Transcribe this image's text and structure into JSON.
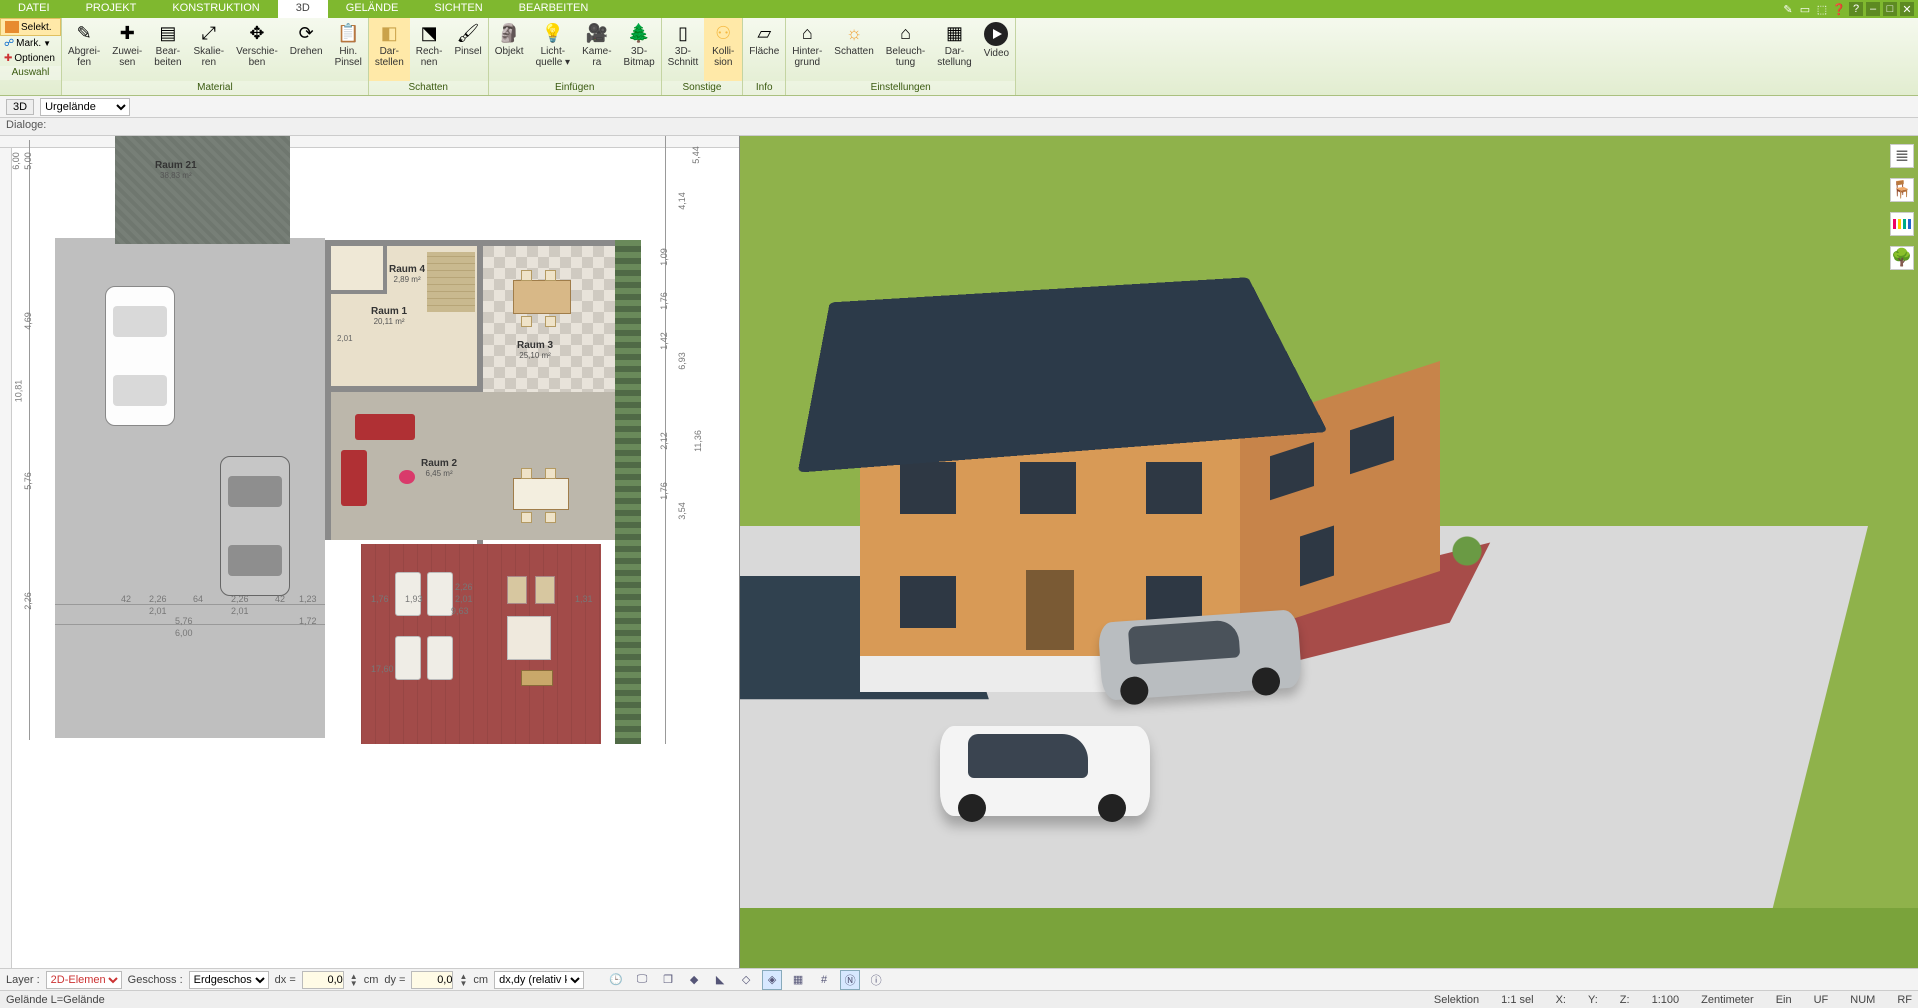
{
  "menu": {
    "tabs": [
      "DATEI",
      "PROJEKT",
      "KONSTRUKTION",
      "3D",
      "GELÄNDE",
      "SICHTEN",
      "BEARBEITEN"
    ],
    "active_index": 3
  },
  "ribbon": {
    "left": {
      "select": "Selekt.",
      "mark": "Mark.",
      "options": "Optionen",
      "group": "Auswahl"
    },
    "groups": [
      {
        "title": "Material",
        "buttons": [
          {
            "id": "abgreifen",
            "label": "Abgrei-\nfen",
            "glyph": "✎"
          },
          {
            "id": "zuweisen",
            "label": "Zuwei-\nsen",
            "glyph": "✚"
          },
          {
            "id": "bearbeiten",
            "label": "Bear-\nbeiten",
            "glyph": "▤"
          },
          {
            "id": "skalieren",
            "label": "Skalie-\nren",
            "glyph": "⤢"
          },
          {
            "id": "verschieben",
            "label": "Verschie-\nben",
            "glyph": "✥"
          },
          {
            "id": "drehen",
            "label": "Drehen",
            "glyph": "⟳"
          },
          {
            "id": "hinpinsel",
            "label": "Hin.\nPinsel",
            "glyph": "📋"
          }
        ]
      },
      {
        "title": "Schatten",
        "buttons": [
          {
            "id": "darstellen",
            "label": "Dar-\nstellen",
            "glyph": "◧",
            "hl": true
          },
          {
            "id": "rechnen",
            "label": "Rech-\nnen",
            "glyph": "⬔"
          },
          {
            "id": "pinsel",
            "label": "Pinsel",
            "glyph": "🖌"
          }
        ]
      },
      {
        "title": "Einfügen",
        "buttons": [
          {
            "id": "objekt",
            "label": "Objekt",
            "glyph": "🗿"
          },
          {
            "id": "lichtquelle",
            "label": "Licht-\nquelle ▾",
            "glyph": "💡"
          },
          {
            "id": "kamera",
            "label": "Kame-\nra",
            "glyph": "🎥"
          },
          {
            "id": "3dbitmap",
            "label": "3D-\nBitmap",
            "glyph": "🌲"
          }
        ]
      },
      {
        "title": "Sonstige",
        "buttons": [
          {
            "id": "3dschnitt",
            "label": "3D-\nSchnitt",
            "glyph": "▯"
          },
          {
            "id": "kollision",
            "label": "Kolli-\nsion",
            "glyph": "⚇",
            "hl": true
          }
        ]
      },
      {
        "title": "Info",
        "buttons": [
          {
            "id": "flaeche",
            "label": "Fläche",
            "glyph": "▱"
          }
        ]
      },
      {
        "title": "Einstellungen",
        "buttons": [
          {
            "id": "hintergrund",
            "label": "Hinter-\ngrund",
            "glyph": "⌂"
          },
          {
            "id": "schattenset",
            "label": "Schatten",
            "glyph": "☼"
          },
          {
            "id": "beleuchtung",
            "label": "Beleuch-\ntung",
            "glyph": "⌂"
          },
          {
            "id": "darstellung",
            "label": "Dar-\nstellung",
            "glyph": "▦"
          },
          {
            "id": "video",
            "label": "Video",
            "glyph": ""
          }
        ]
      }
    ]
  },
  "subbar": {
    "mode": "3D",
    "layer": "Urgelände"
  },
  "dialoge_label": "Dialoge:",
  "plan": {
    "rooms": {
      "r21": {
        "name": "Raum 21",
        "area": "38,83 m²"
      },
      "r4": {
        "name": "Raum 4",
        "area": "2,89 m²"
      },
      "r1": {
        "name": "Raum 1",
        "area": "20,11 m²"
      },
      "r3": {
        "name": "Raum 3",
        "area": "25,10 m²"
      },
      "r2": {
        "name": "Raum 2",
        "area": "6,45 m²"
      }
    },
    "dims_left": [
      "6,00",
      "5,00",
      "4,69",
      "10,81",
      "5,76",
      "2,26",
      "2,01"
    ],
    "dims_right": [
      "5,44",
      "4,14",
      "1,09",
      "1,76",
      "1,42",
      "6,93",
      "2,12",
      "1,76",
      "3,54",
      "11,36"
    ],
    "dims_bottom": [
      "42",
      "2,26",
      "2,01",
      "64",
      "2,26",
      "2,01",
      "42",
      "1,23",
      "5,76",
      "6,00",
      "9,63",
      "1,76",
      "1,31",
      "1,93",
      "2,01",
      "2,26",
      "1,72",
      "17,60"
    ]
  },
  "optbar": {
    "layer_label": "Layer :",
    "layer_value": "2D-Elemen",
    "floor_label": "Geschoss :",
    "floor_value": "Erdgeschos",
    "dx_label": "dx =",
    "dx_value": "0,0",
    "dy_label": "dy =",
    "dy_value": "0,0",
    "unit": "cm",
    "mode": "dx,dy (relativ ka"
  },
  "status": {
    "left": "Gelände L=Gelände",
    "selection": "Selektion",
    "scale_lbl": "1:1 sel",
    "x_lbl": "X:",
    "y_lbl": "Y:",
    "z_lbl": "Z:",
    "scale2": "1:100",
    "unit": "Zentimeter",
    "ein": "Ein",
    "uf": "UF",
    "num": "NUM",
    "rf": "RF"
  }
}
